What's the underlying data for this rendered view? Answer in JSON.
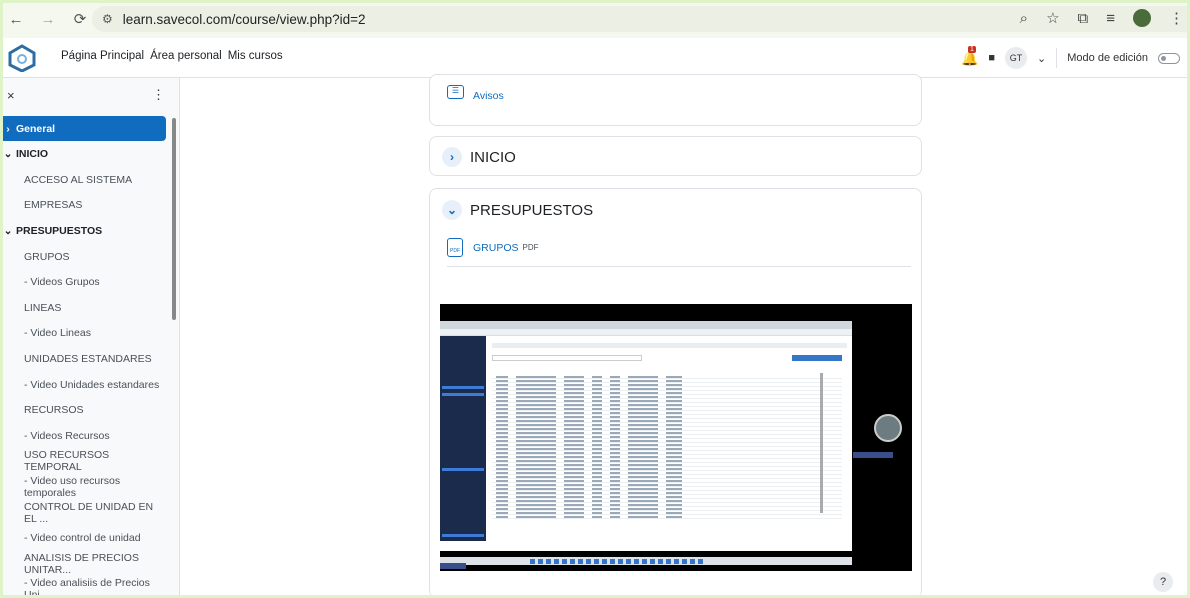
{
  "browser": {
    "url": "learn.savecol.com/course/view.php?id=2"
  },
  "header": {
    "nav": [
      "Página Principal",
      "Área personal",
      "Mis cursos"
    ],
    "user_initials": "GT",
    "notifications_count": "1",
    "edit_mode_label": "Modo de edición"
  },
  "sidebar": {
    "close": "×",
    "menu": "⋮",
    "items": [
      {
        "label": "General",
        "kind": "active"
      },
      {
        "label": "INICIO",
        "kind": "section"
      },
      {
        "label": "ACCESO AL SISTEMA",
        "kind": "item"
      },
      {
        "label": "EMPRESAS",
        "kind": "item"
      },
      {
        "label": "PRESUPUESTOS",
        "kind": "section"
      },
      {
        "label": "GRUPOS",
        "kind": "item"
      },
      {
        "label": "- Videos Grupos",
        "kind": "item"
      },
      {
        "label": "LINEAS",
        "kind": "item"
      },
      {
        "label": "- Video Lineas",
        "kind": "item"
      },
      {
        "label": "UNIDADES ESTANDARES",
        "kind": "item"
      },
      {
        "label": "- Video Unidades estandares",
        "kind": "item"
      },
      {
        "label": "RECURSOS",
        "kind": "item"
      },
      {
        "label": "- Videos Recursos",
        "kind": "item"
      },
      {
        "label": "USO RECURSOS TEMPORAL",
        "kind": "item"
      },
      {
        "label": "- Video uso recursos temporales",
        "kind": "item"
      },
      {
        "label": "CONTROL DE UNIDAD EN EL ...",
        "kind": "item"
      },
      {
        "label": "- Video control de unidad",
        "kind": "item"
      },
      {
        "label": "ANALISIS DE PRECIOS UNITAR...",
        "kind": "item"
      },
      {
        "label": "- Video analisiis de Precios Uni...",
        "kind": "item"
      }
    ]
  },
  "main": {
    "avisos": "Avisos",
    "inicio_title": "INICIO",
    "presupuestos_title": "PRESUPUESTOS",
    "grupos_link": "GRUPOS",
    "grupos_type": "PDF"
  },
  "help": "?"
}
